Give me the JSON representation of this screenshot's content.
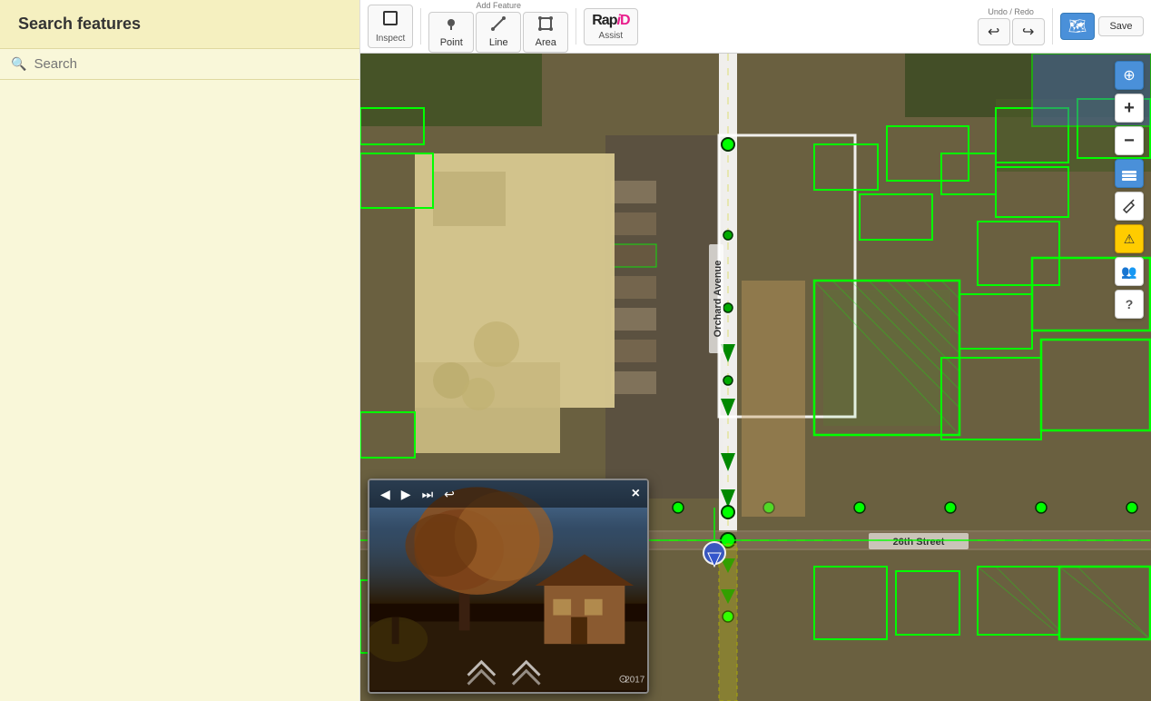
{
  "sidebar": {
    "title": "Search features",
    "search": {
      "placeholder": "Search",
      "value": ""
    }
  },
  "toolbar": {
    "inspect": {
      "label": "Inspect",
      "icon": "⬛"
    },
    "add_feature": {
      "label": "Add Feature",
      "point": {
        "label": "Point",
        "icon": "📍"
      },
      "line": {
        "label": "Line",
        "icon": "✏️"
      },
      "area": {
        "label": "Area",
        "icon": "⬜"
      }
    },
    "assist": {
      "label": "Assist",
      "icon": "RapiD"
    },
    "undo_redo": {
      "label": "Undo / Redo",
      "undo_icon": "↩",
      "redo_icon": "↪"
    },
    "save": {
      "label": "Save"
    },
    "layers_icon": "🗂",
    "compass_icon": "🧭"
  },
  "map": {
    "street_label": "Orchard Avenue",
    "street_label_2": "26th Street",
    "controls": {
      "zoom_in": "+",
      "zoom_out": "−",
      "compass": "⊕",
      "layers": "⊞",
      "edit": "✏",
      "warning": "⚠",
      "users": "👥",
      "help": "?"
    }
  },
  "streetview": {
    "year": "2017",
    "nav_prev": "◀",
    "nav_play": "▶",
    "nav_next": "⏭",
    "nav_back": "↩",
    "close": "×"
  }
}
